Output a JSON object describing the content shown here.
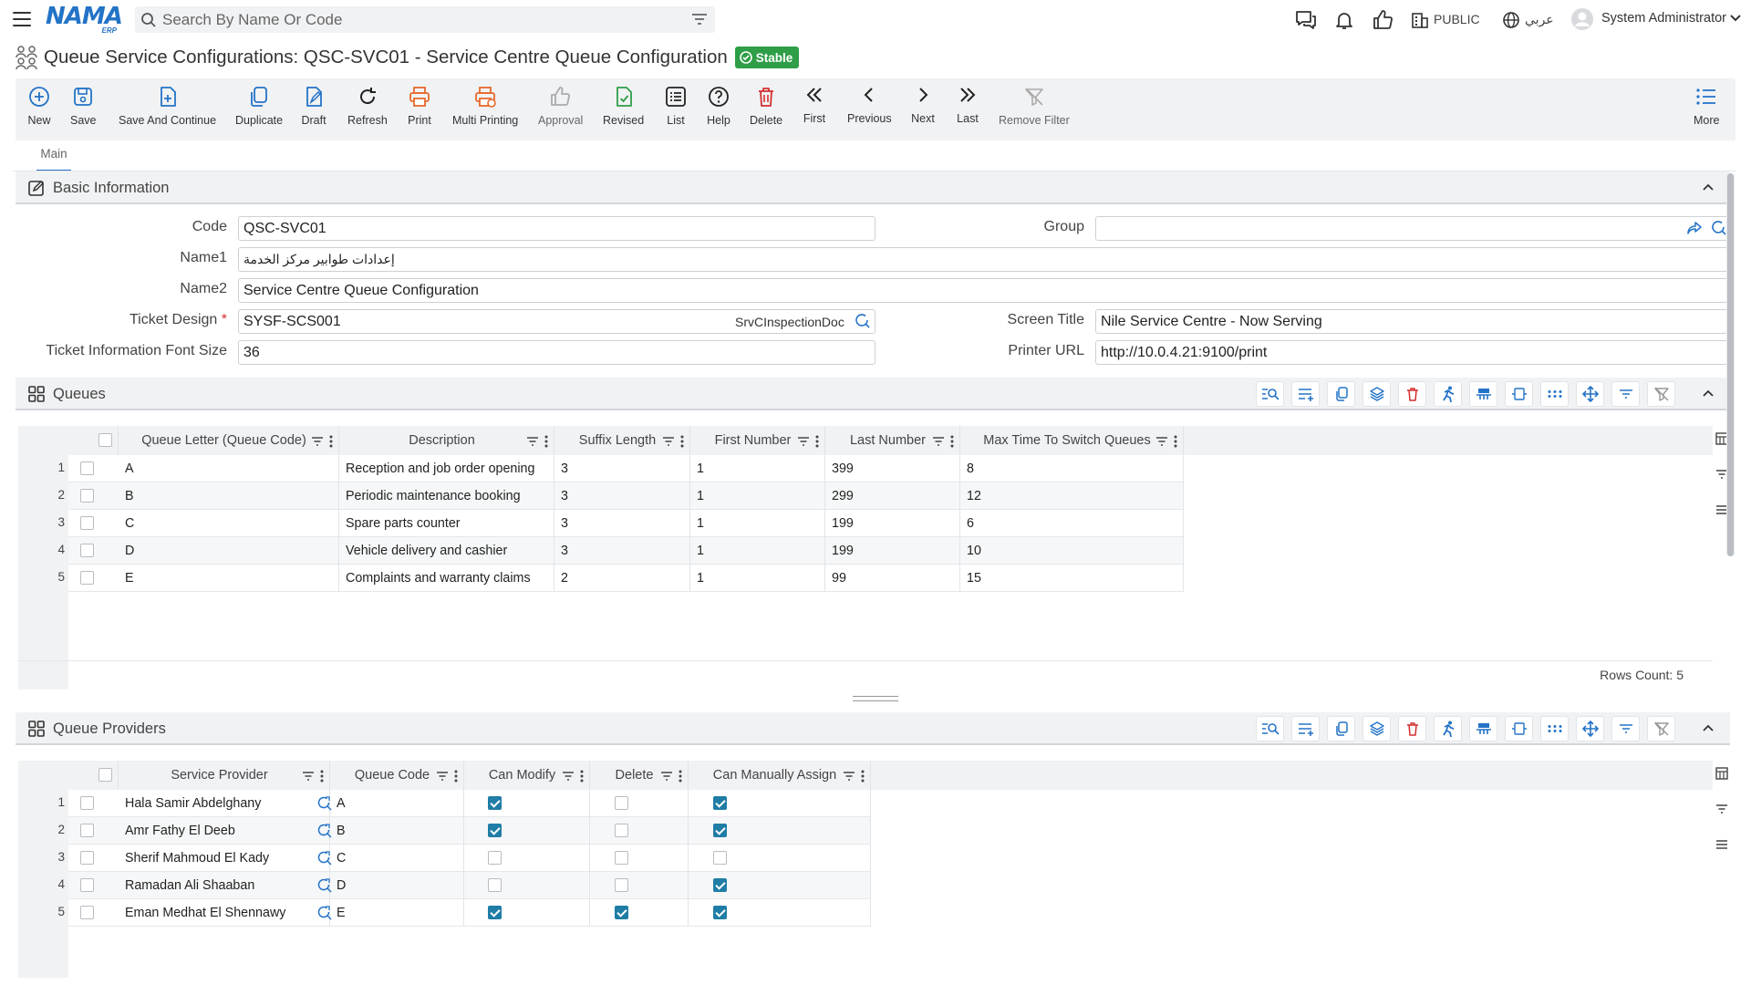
{
  "header": {
    "logo_text": "NAMA",
    "logo_sub": "ERP",
    "search_placeholder": "Search By Name Or Code",
    "public_label": "PUBLIC",
    "language_label": "عربي",
    "user_name": "System Administrator"
  },
  "page": {
    "title": "Queue Service Configurations: QSC-SVC01 - Service Centre Queue Configuration",
    "status": "Stable"
  },
  "toolbar": {
    "new": "New",
    "save": "Save",
    "save_continue": "Save And Continue",
    "duplicate": "Duplicate",
    "draft": "Draft",
    "refresh": "Refresh",
    "print": "Print",
    "multi_printing": "Multi Printing",
    "approval": "Approval",
    "revised": "Revised",
    "list": "List",
    "help": "Help",
    "delete": "Delete",
    "first": "First",
    "previous": "Previous",
    "next": "Next",
    "last": "Last",
    "remove_filter": "Remove Filter",
    "more": "More"
  },
  "tabs": {
    "main": "Main"
  },
  "basic_info": {
    "title": "Basic Information",
    "code_label": "Code",
    "code_value": "QSC-SVC01",
    "group_label": "Group",
    "group_value": "",
    "name1_label": "Name1",
    "name1_value": "إعدادات طوابير مركز الخدمة",
    "name2_label": "Name2",
    "name2_value": "Service Centre Queue Configuration",
    "ticket_design_label": "Ticket Design",
    "ticket_design_value": "SYSF-SCS001",
    "ticket_design_tag": "SrvCInspectionDoc",
    "screen_title_label": "Screen Title",
    "screen_title_value": "Nile Service Centre - Now Serving",
    "font_size_label": "Ticket Information Font Size",
    "font_size_value": "36",
    "printer_url_label": "Printer URL",
    "printer_url_value": "http://10.0.4.21:9100/print"
  },
  "queues": {
    "title": "Queues",
    "columns": [
      "Queue Letter (Queue Code)",
      "Description",
      "Suffix Length",
      "First Number",
      "Last Number",
      "Max Time To Switch Queues"
    ],
    "rows": [
      {
        "n": "1",
        "letter": "A",
        "desc": "Reception and job order opening",
        "suffix": "3",
        "first": "1",
        "last": "399",
        "max": "8"
      },
      {
        "n": "2",
        "letter": "B",
        "desc": "Periodic maintenance booking",
        "suffix": "3",
        "first": "1",
        "last": "299",
        "max": "12"
      },
      {
        "n": "3",
        "letter": "C",
        "desc": "Spare parts counter",
        "suffix": "3",
        "first": "1",
        "last": "199",
        "max": "6"
      },
      {
        "n": "4",
        "letter": "D",
        "desc": "Vehicle delivery and cashier",
        "suffix": "3",
        "first": "1",
        "last": "199",
        "max": "10"
      },
      {
        "n": "5",
        "letter": "E",
        "desc": "Complaints and warranty claims",
        "suffix": "2",
        "first": "1",
        "last": "99",
        "max": "15"
      }
    ],
    "rows_count": "Rows Count: 5"
  },
  "providers": {
    "title": "Queue Providers",
    "columns": [
      "Service Provider",
      "Queue Code",
      "Can Modify",
      "Delete",
      "Can Manually Assign"
    ],
    "rows": [
      {
        "n": "1",
        "provider": "Hala Samir Abdelghany",
        "code": "A",
        "modify": true,
        "del": false,
        "assign": true
      },
      {
        "n": "2",
        "provider": "Amr Fathy El Deeb",
        "code": "B",
        "modify": true,
        "del": false,
        "assign": true
      },
      {
        "n": "3",
        "provider": "Sherif Mahmoud El Kady",
        "code": "C",
        "modify": false,
        "del": false,
        "assign": false
      },
      {
        "n": "4",
        "provider": "Ramadan Ali Shaaban",
        "code": "D",
        "modify": false,
        "del": false,
        "assign": true
      },
      {
        "n": "5",
        "provider": "Eman Medhat El Shennawy",
        "code": "E",
        "modify": true,
        "del": true,
        "assign": true
      }
    ]
  },
  "colors": {
    "accent": "#2373c7",
    "status_green": "#2e9e47",
    "checkbox_on": "#1f7da6",
    "delete_red": "#d32f2f",
    "print_orange": "#e8692c"
  }
}
